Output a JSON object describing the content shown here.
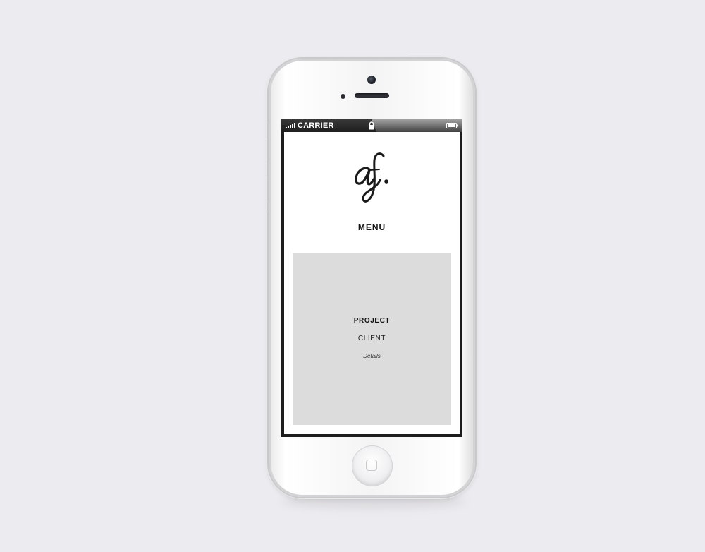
{
  "status_bar": {
    "carrier": "CARRIER",
    "signal_icon": "signal-bars-icon",
    "lock_icon": "lock-icon",
    "battery_icon": "battery-icon"
  },
  "header": {
    "logo_text": "af.",
    "menu_label": "MENU"
  },
  "project_card": {
    "project_label": "PROJECT",
    "client_label": "CLIENT",
    "details_label": "Details"
  },
  "colors": {
    "background": "#ecebef",
    "card": "#dcdcdd",
    "text": "#111111"
  }
}
